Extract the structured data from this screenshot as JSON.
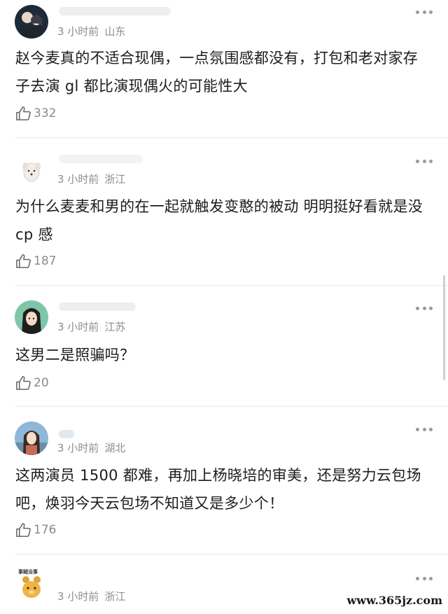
{
  "comments": [
    {
      "meta_time": "3 小时前",
      "meta_location": "山东",
      "text": "赵今麦真的不适合现偶，一点氛围感都没有，打包和老对家存子去演 gl 都比演现偶火的可能性大",
      "likes": "332",
      "avatar": "dark-anime-couple-avatar"
    },
    {
      "meta_time": "3 小时前",
      "meta_location": "浙江",
      "text": "为什么麦麦和男的在一起就触发变憨的被动 明明挺好看就是没 cp 感",
      "likes": "187",
      "avatar": "white-dog-avatar"
    },
    {
      "meta_time": "3 小时前",
      "meta_location": "江苏",
      "text": "这男二是照骗吗？",
      "likes": "20",
      "avatar": "anime-girl-avatar"
    },
    {
      "meta_time": "3 小时前",
      "meta_location": "湖北",
      "text": "这两演员 1500 都难，再加上杨晓培的审美，还是努力云包场吧，焕羽今天云包场不知道又是多少个！",
      "likes": "176",
      "avatar": "photo-girl-avatar"
    },
    {
      "meta_time": "3 小时前",
      "meta_location": "浙江",
      "text": "",
      "likes": "",
      "avatar": "cartoon-bear-avatar",
      "avatar_badge_text": "事贼没事"
    }
  ],
  "watermark": "www.365jz.com",
  "colors": {
    "meta": "#8d8d8d",
    "divider": "#e9e9e9",
    "text": "#1c1c1c"
  }
}
